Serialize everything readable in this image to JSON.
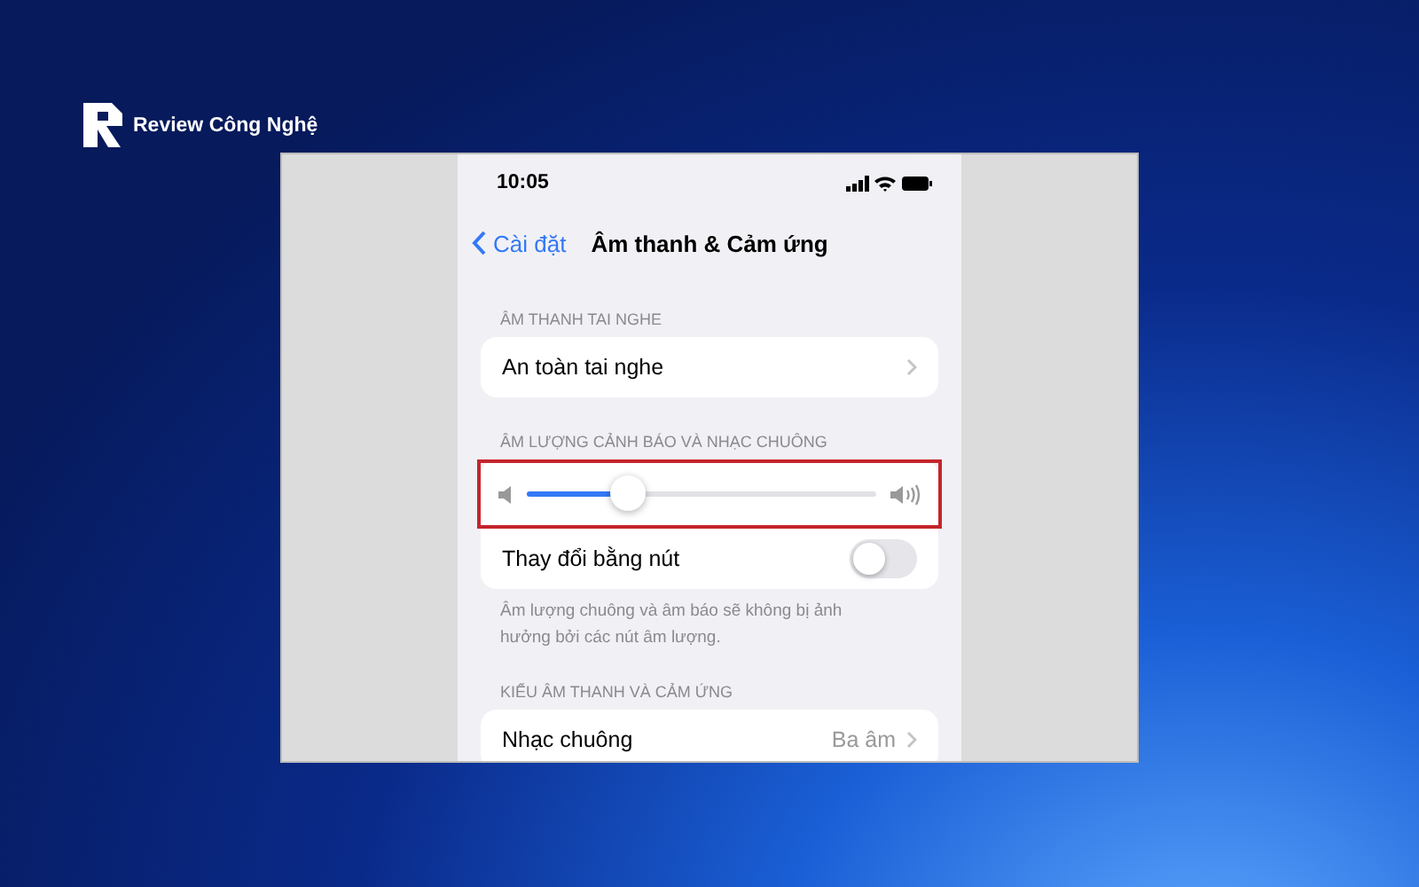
{
  "brand": {
    "name": "Review Công Nghệ"
  },
  "status_bar": {
    "time": "10:05"
  },
  "nav": {
    "back": "Cài đặt",
    "title": "Âm thanh & Cảm ứng"
  },
  "sections": [
    {
      "kind": "list",
      "header": "ÂM THANH TAI NGHE",
      "rows": [
        {
          "kind": "link",
          "label": "An toàn tai nghe"
        }
      ]
    },
    {
      "kind": "volume",
      "header": "ÂM LƯỢNG CẢNH BÁO VÀ NHẠC CHUÔNG",
      "highlighted": true,
      "slider": {
        "level": 0.29
      },
      "rows": [
        {
          "kind": "toggle",
          "label": "Thay đổi bằng nút",
          "on": false
        }
      ],
      "footer": "Âm lượng chuông và âm báo sẽ không bị ảnh hưởng bởi các nút âm lượng."
    },
    {
      "kind": "list",
      "header": "KIỂU ÂM THANH VÀ CẢM ỨNG",
      "rows": [
        {
          "kind": "link",
          "label": "Nhạc chuông",
          "value": "Ba âm"
        }
      ]
    }
  ]
}
